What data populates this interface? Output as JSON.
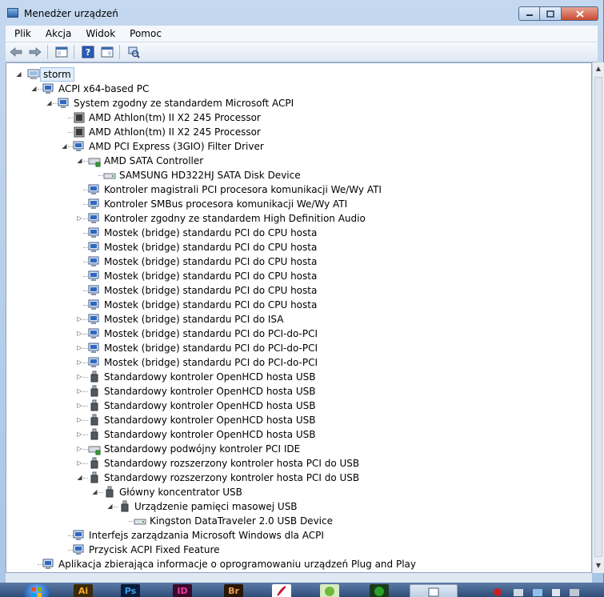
{
  "window": {
    "title": "Menedżer urządzeń"
  },
  "menu": {
    "items": [
      "Plik",
      "Akcja",
      "Widok",
      "Pomoc"
    ]
  },
  "tree": [
    {
      "label": "storm",
      "level": 0,
      "exp": "open",
      "icon": "computer-icon",
      "selected": true
    },
    {
      "label": "ACPI x64-based PC",
      "level": 1,
      "exp": "open",
      "icon": "device-icon"
    },
    {
      "label": "System zgodny ze standardem Microsoft ACPI",
      "level": 2,
      "exp": "open",
      "icon": "device-icon"
    },
    {
      "label": "AMD Athlon(tm) II X2 245 Processor",
      "level": 3,
      "exp": "none",
      "icon": "processor-icon"
    },
    {
      "label": "AMD Athlon(tm) II X2 245 Processor",
      "level": 3,
      "exp": "none",
      "icon": "processor-icon"
    },
    {
      "label": "AMD PCI Express (3GIO) Filter Driver",
      "level": 3,
      "exp": "open",
      "icon": "device-icon"
    },
    {
      "label": "AMD SATA Controller",
      "level": 4,
      "exp": "open",
      "icon": "storage-controller-icon"
    },
    {
      "label": "SAMSUNG HD322HJ SATA Disk Device",
      "level": 5,
      "exp": "none",
      "icon": "disk-drive-icon"
    },
    {
      "label": "Kontroler magistrali PCI procesora komunikacji We/Wy ATI",
      "level": 4,
      "exp": "none",
      "icon": "device-icon"
    },
    {
      "label": "Kontroler SMBus procesora komunikacji We/Wy ATI",
      "level": 4,
      "exp": "none",
      "icon": "device-icon"
    },
    {
      "label": "Kontroler zgodny ze standardem High Definition Audio",
      "level": 4,
      "exp": "closed",
      "icon": "device-icon"
    },
    {
      "label": "Mostek (bridge) standardu PCI do CPU hosta",
      "level": 4,
      "exp": "none",
      "icon": "device-icon"
    },
    {
      "label": "Mostek (bridge) standardu PCI do CPU hosta",
      "level": 4,
      "exp": "none",
      "icon": "device-icon"
    },
    {
      "label": "Mostek (bridge) standardu PCI do CPU hosta",
      "level": 4,
      "exp": "none",
      "icon": "device-icon"
    },
    {
      "label": "Mostek (bridge) standardu PCI do CPU hosta",
      "level": 4,
      "exp": "none",
      "icon": "device-icon"
    },
    {
      "label": "Mostek (bridge) standardu PCI do CPU hosta",
      "level": 4,
      "exp": "none",
      "icon": "device-icon"
    },
    {
      "label": "Mostek (bridge) standardu PCI do CPU hosta",
      "level": 4,
      "exp": "none",
      "icon": "device-icon"
    },
    {
      "label": "Mostek (bridge) standardu PCI do ISA",
      "level": 4,
      "exp": "closed",
      "icon": "device-icon"
    },
    {
      "label": "Mostek (bridge) standardu PCI do PCI-do-PCI",
      "level": 4,
      "exp": "closed",
      "icon": "device-icon"
    },
    {
      "label": "Mostek (bridge) standardu PCI do PCI-do-PCI",
      "level": 4,
      "exp": "closed",
      "icon": "device-icon"
    },
    {
      "label": "Mostek (bridge) standardu PCI do PCI-do-PCI",
      "level": 4,
      "exp": "closed",
      "icon": "device-icon"
    },
    {
      "label": "Standardowy kontroler OpenHCD hosta USB",
      "level": 4,
      "exp": "closed",
      "icon": "usb-icon"
    },
    {
      "label": "Standardowy kontroler OpenHCD hosta USB",
      "level": 4,
      "exp": "closed",
      "icon": "usb-icon"
    },
    {
      "label": "Standardowy kontroler OpenHCD hosta USB",
      "level": 4,
      "exp": "closed",
      "icon": "usb-icon"
    },
    {
      "label": "Standardowy kontroler OpenHCD hosta USB",
      "level": 4,
      "exp": "closed",
      "icon": "usb-icon"
    },
    {
      "label": "Standardowy kontroler OpenHCD hosta USB",
      "level": 4,
      "exp": "closed",
      "icon": "usb-icon"
    },
    {
      "label": "Standardowy podwójny kontroler PCI IDE",
      "level": 4,
      "exp": "closed",
      "icon": "storage-controller-icon"
    },
    {
      "label": "Standardowy rozszerzony kontroler hosta PCI do USB",
      "level": 4,
      "exp": "closed",
      "icon": "usb-icon"
    },
    {
      "label": "Standardowy rozszerzony kontroler hosta PCI do USB",
      "level": 4,
      "exp": "open",
      "icon": "usb-icon"
    },
    {
      "label": "Główny koncentrator USB",
      "level": 5,
      "exp": "open",
      "icon": "usb-icon"
    },
    {
      "label": "Urządzenie pamięci masowej USB",
      "level": 6,
      "exp": "open",
      "icon": "usb-icon"
    },
    {
      "label": "Kingston DataTraveler 2.0 USB Device",
      "level": 7,
      "exp": "none",
      "icon": "disk-drive-icon"
    },
    {
      "label": "Interfejs zarządzania Microsoft Windows dla ACPI",
      "level": 3,
      "exp": "none",
      "icon": "device-icon"
    },
    {
      "label": "Przycisk ACPI Fixed Feature",
      "level": 3,
      "exp": "none",
      "icon": "device-icon"
    },
    {
      "label": "Aplikacja zbierająca informacje o oprogramowaniu urządzeń Plug and Play",
      "level": 1,
      "exp": "none",
      "icon": "device-icon"
    }
  ],
  "taskbar": {
    "apps": [
      {
        "label": "Ai",
        "name": "illustrator-taskbar-button"
      },
      {
        "label": "Ps",
        "name": "photoshop-taskbar-button"
      },
      {
        "label": "ID",
        "name": "indesign-taskbar-button"
      },
      {
        "label": "Br",
        "name": "bridge-taskbar-button"
      }
    ]
  }
}
